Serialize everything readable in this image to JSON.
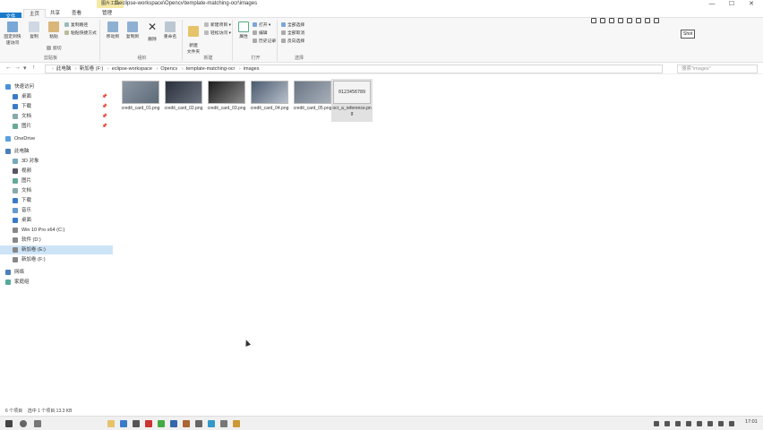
{
  "titlebar": {
    "context_tab": "图片工具",
    "path": "f:\\eclipse-workspace\\Opencv\\template-matching-ocr\\images",
    "minimize": "—",
    "maximize": "☐",
    "close": "✕"
  },
  "ribbon_tabs": {
    "file": "文件",
    "home": "主页",
    "share": "共享",
    "view": "查看",
    "manage": "管理"
  },
  "ribbon": {
    "clipboard": {
      "pin": "固定到快速访问",
      "copy": "复制",
      "paste": "粘贴",
      "copy_path": "复制路径",
      "paste_shortcut": "粘贴快捷方式",
      "cut": "剪切",
      "label": "剪贴板"
    },
    "organize": {
      "move_to": "移动到",
      "copy_to": "复制到",
      "delete": "删除",
      "rename": "重命名",
      "label": "组织"
    },
    "new": {
      "new_folder": "新建\n文件夹",
      "new_item": "新建项目 ▾",
      "easy_access": "轻松访问 ▾",
      "label": "新建"
    },
    "open": {
      "properties": "属性",
      "open": "打开 ▾",
      "edit": "编辑",
      "history": "历史记录",
      "label": "打开"
    },
    "select": {
      "select_all": "全部选择",
      "select_none": "全部取消",
      "invert": "反向选择",
      "label": "选择"
    },
    "tooltip": "Shot"
  },
  "address": {
    "back": "←",
    "forward": "→",
    "down": "▾",
    "up": "↑",
    "crumbs": [
      "此电脑",
      "新加卷 (F:)",
      "eclipse-workspace",
      "Opencv",
      "template-matching-ocr",
      "images"
    ],
    "search_placeholder": "搜索\"images\""
  },
  "navpane": {
    "quick_access": "快速访问",
    "desktop_qa": "桌面",
    "downloads_qa": "下载",
    "documents_qa": "文档",
    "pictures_qa": "图片",
    "onedrive": "OneDrive",
    "this_pc": "此电脑",
    "objects3d": "3D 对象",
    "videos": "视频",
    "pictures": "图片",
    "documents": "文档",
    "downloads": "下载",
    "music": "音乐",
    "desktop": "桌面",
    "drive_c": "Win 10 Pro x64 (C:)",
    "drive_d": "软件 (D:)",
    "drive_e": "新加卷 (E:)",
    "drive_f": "新加卷 (F:)",
    "network": "网络",
    "homegroup": "家庭组"
  },
  "files": [
    {
      "name": "credit_card_01.png"
    },
    {
      "name": "credit_card_02.png"
    },
    {
      "name": "credit_card_03.png"
    },
    {
      "name": "credit_card_04.png"
    },
    {
      "name": "credit_card_05.png"
    },
    {
      "name": "ocr_a_reference.png",
      "thumb_text": "0123456789"
    }
  ],
  "status": {
    "count": "6 个项目",
    "selected": "选中 1 个项目  13.3 KB"
  },
  "taskbar": {
    "clock": "17:01"
  },
  "colors": {
    "accent": "#1979ca",
    "context_tab": "#f6e9a6",
    "selection": "#cde4f7"
  }
}
